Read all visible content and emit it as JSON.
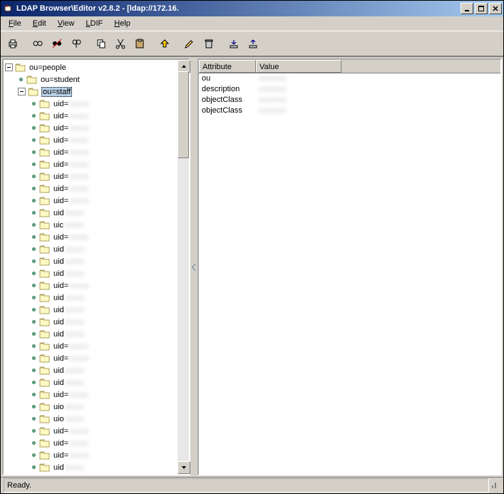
{
  "title": "LDAP Browser\\Editor v2.8.2 - [ldap://172.16.",
  "menu": {
    "file": "File",
    "edit": "Edit",
    "view": "View",
    "ldif": "LDIF",
    "help": "Help"
  },
  "tree": {
    "root": "ou=people",
    "student": "ou=student",
    "staff": "ou=staff",
    "uid_prefix": "uid=",
    "uid_prefix_short": "uid",
    "uid_prefix_uic": "uic"
  },
  "attrs": {
    "header_attr": "Attribute",
    "header_val": "Value",
    "rows": [
      {
        "a": "ou",
        "v": ""
      },
      {
        "a": "description",
        "v": ""
      },
      {
        "a": "objectClass",
        "v": ""
      },
      {
        "a": "objectClass",
        "v": ""
      }
    ]
  },
  "status": "Ready.",
  "winbtn": {
    "min": "_",
    "max": "□",
    "close": "×"
  }
}
